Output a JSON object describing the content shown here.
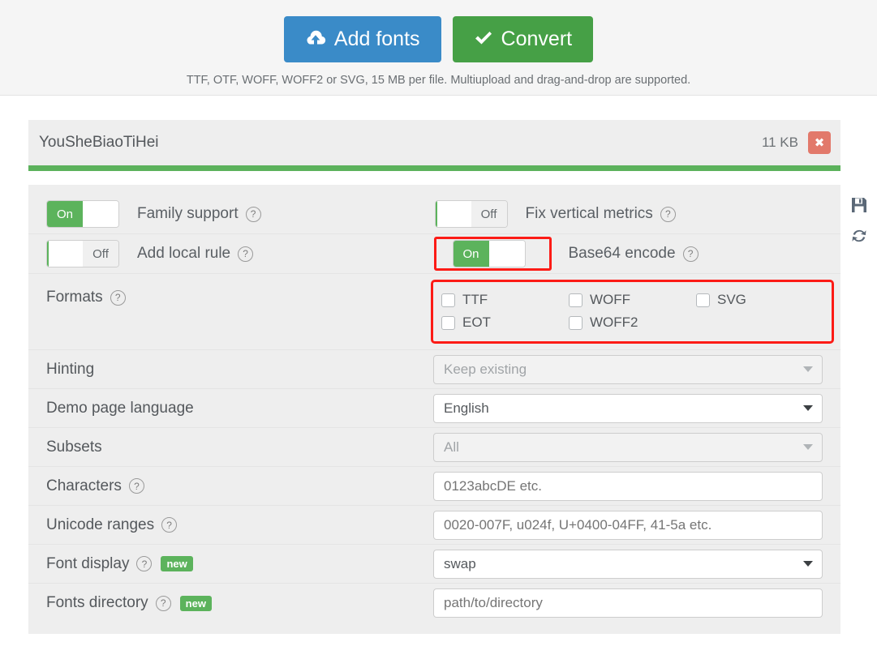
{
  "topbar": {
    "add_fonts_label": "Add fonts",
    "convert_label": "Convert",
    "note": "TTF, OTF, WOFF, WOFF2 or SVG, 15 MB per file. Multiupload and drag-and-drop are supported."
  },
  "file_card": {
    "name": "YouSheBiaoTiHei",
    "size": "11 KB",
    "close_glyph": "✖",
    "progress_percent": 100
  },
  "side_icons": {
    "save": "save-icon",
    "refresh": "refresh-icon"
  },
  "toggles": [
    {
      "label": "Family support",
      "state": "On",
      "highlighted": false
    },
    {
      "label": "Fix vertical metrics",
      "state": "Off",
      "highlighted": false
    },
    {
      "label": "Add local rule",
      "state": "Off",
      "highlighted": false
    },
    {
      "label": "Base64 encode",
      "state": "On",
      "highlighted": true
    }
  ],
  "formats": {
    "label": "Formats",
    "highlighted": true,
    "items": [
      {
        "label": "TTF",
        "checked": false
      },
      {
        "label": "WOFF",
        "checked": false
      },
      {
        "label": "SVG",
        "checked": false
      },
      {
        "label": "EOT",
        "checked": false
      },
      {
        "label": "WOFF2",
        "checked": false
      }
    ]
  },
  "fields": [
    {
      "label": "Hinting",
      "help": true,
      "badge": null,
      "value": "Keep existing",
      "is_placeholder": true,
      "type": "select",
      "disabled": true
    },
    {
      "label": "Demo page language",
      "help": false,
      "badge": null,
      "value": "English",
      "is_placeholder": false,
      "type": "select",
      "disabled": false
    },
    {
      "label": "Subsets",
      "help": false,
      "badge": null,
      "value": "All",
      "is_placeholder": true,
      "type": "select",
      "disabled": true
    },
    {
      "label": "Characters",
      "help": true,
      "badge": null,
      "value": "0123abcDE etc.",
      "is_placeholder": true,
      "type": "text",
      "disabled": false
    },
    {
      "label": "Unicode ranges",
      "help": true,
      "badge": null,
      "value": "0020-007F, u024f, U+0400-04FF, 41-5a etc.",
      "is_placeholder": true,
      "type": "text",
      "disabled": false
    },
    {
      "label": "Font display",
      "help": true,
      "badge": "new",
      "value": "swap",
      "is_placeholder": false,
      "type": "select",
      "disabled": false
    },
    {
      "label": "Fonts directory",
      "help": true,
      "badge": "new",
      "value": "path/to/directory",
      "is_placeholder": true,
      "type": "text",
      "disabled": false
    }
  ],
  "colors": {
    "accent_blue": "#3a8bc8",
    "accent_green": "#46a046",
    "progress_green": "#5cb25c",
    "highlight_red": "#fc1b16",
    "close_red": "#e2796b",
    "panel_grey": "#eeeeee"
  }
}
